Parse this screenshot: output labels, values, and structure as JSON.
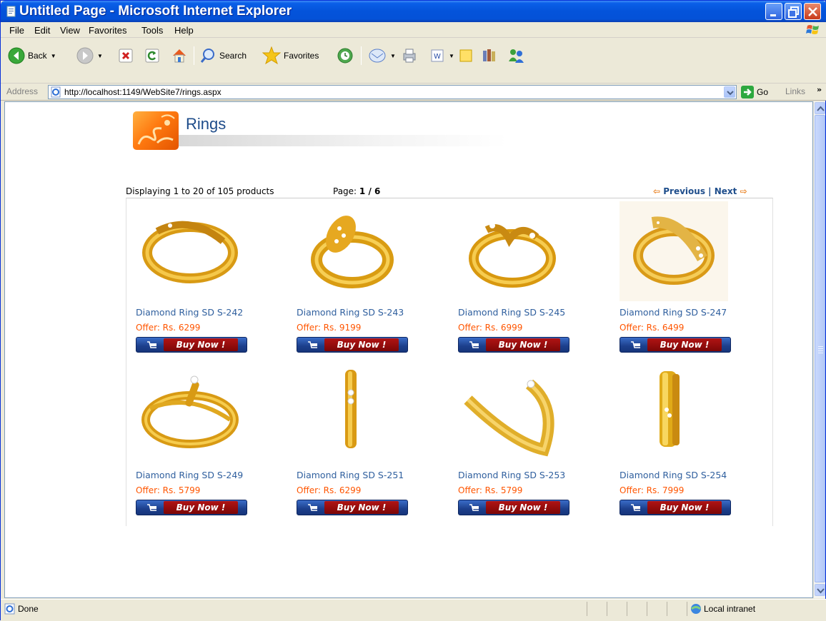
{
  "window": {
    "title": "Untitled Page - Microsoft Internet Explorer"
  },
  "menu": {
    "items": [
      "File",
      "Edit",
      "View",
      "Favorites",
      "Tools",
      "Help"
    ]
  },
  "toolbar": {
    "back_label": "Back",
    "search_label": "Search",
    "favorites_label": "Favorites"
  },
  "address": {
    "label": "Address",
    "url": "http://localhost:1149/WebSite7/rings.aspx",
    "go_label": "Go",
    "links_label": "Links"
  },
  "page": {
    "heading": "Rings",
    "displaying": "Displaying 1 to 20 of 105 products",
    "page_prefix": "Page:",
    "page_current": "1 / 6",
    "previous_label": "Previous",
    "separator": "|",
    "next_label": "Next",
    "buy_label": "Buy Now !",
    "products": [
      {
        "name": "Diamond Ring SD S-242",
        "price": "Offer: Rs. 6299"
      },
      {
        "name": "Diamond Ring SD S-243",
        "price": "Offer: Rs. 9199"
      },
      {
        "name": "Diamond Ring SD S-245",
        "price": "Offer: Rs. 6999"
      },
      {
        "name": "Diamond Ring SD S-247",
        "price": "Offer: Rs. 6499"
      },
      {
        "name": "Diamond Ring SD S-249",
        "price": "Offer: Rs. 5799"
      },
      {
        "name": "Diamond Ring SD S-251",
        "price": "Offer: Rs. 6299"
      },
      {
        "name": "Diamond Ring SD S-253",
        "price": "Offer: Rs. 5799"
      },
      {
        "name": "Diamond Ring SD S-254",
        "price": "Offer: Rs. 7999"
      }
    ]
  },
  "status": {
    "text": "Done",
    "zone": "Local intranet"
  },
  "colors": {
    "title_bar": "#0453DA",
    "link_blue": "#2F5F9E",
    "price_orange": "#FF5500",
    "buy_red": "#9E0E0E",
    "gold": "#E0A81A"
  }
}
